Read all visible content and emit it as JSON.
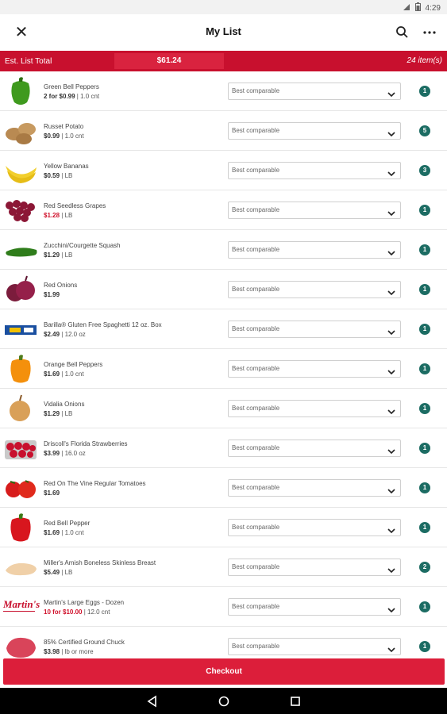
{
  "status": {
    "time": "4:29"
  },
  "appbar": {
    "title": "My List",
    "close_icon": "close-icon",
    "search_icon": "search-icon",
    "more_icon": "more-vert-icon"
  },
  "summary": {
    "label": "Est. List Total",
    "total": "$61.24",
    "count": "24 item(s)"
  },
  "colors": {
    "brand_red": "#c8102e",
    "qty_green": "#1c6c63",
    "sale_red": "#d0112b"
  },
  "select_default": "Best comparable",
  "items": [
    {
      "name": "Green Bell Peppers",
      "price": "2 for $0.99",
      "unit": "1.0 cnt",
      "sale": false,
      "qty": "1",
      "icon": "green-pepper"
    },
    {
      "name": "Russet Potato",
      "price": "$0.99",
      "unit": "1.0 cnt",
      "sale": false,
      "qty": "5",
      "icon": "potato"
    },
    {
      "name": "Yellow Bananas",
      "price": "$0.59",
      "unit": "LB",
      "sale": false,
      "qty": "3",
      "icon": "banana"
    },
    {
      "name": "Red Seedless Grapes",
      "price": "$1.28",
      "unit": "LB",
      "sale": true,
      "qty": "1",
      "icon": "grapes"
    },
    {
      "name": "Zucchini/Courgette Squash",
      "price": "$1.29",
      "unit": "LB",
      "sale": false,
      "qty": "1",
      "icon": "zucchini"
    },
    {
      "name": "Red Onions",
      "price": "$1.99",
      "unit": "",
      "sale": false,
      "qty": "1",
      "icon": "red-onion"
    },
    {
      "name": "Barilla® Gluten Free Spaghetti 12 oz. Box",
      "price": "$2.49",
      "unit": "12.0 oz",
      "sale": false,
      "qty": "1",
      "icon": "pasta-box"
    },
    {
      "name": "Orange Bell Peppers",
      "price": "$1.69",
      "unit": "1.0 cnt",
      "sale": false,
      "qty": "1",
      "icon": "orange-pepper"
    },
    {
      "name": "Vidalia Onions",
      "price": "$1.29",
      "unit": "LB",
      "sale": false,
      "qty": "1",
      "icon": "onion"
    },
    {
      "name": "Driscoll's Florida Strawberries",
      "price": "$3.99",
      "unit": "16.0 oz",
      "sale": false,
      "qty": "1",
      "icon": "strawberries"
    },
    {
      "name": "Red On The Vine Regular Tomatoes",
      "price": "$1.69",
      "unit": "",
      "sale": false,
      "qty": "1",
      "icon": "tomatoes"
    },
    {
      "name": "Red Bell Pepper",
      "price": "$1.69",
      "unit": "1.0 cnt",
      "sale": false,
      "qty": "1",
      "icon": "red-pepper"
    },
    {
      "name": "Miller's Amish Boneless Skinless Breast",
      "price": "$5.49",
      "unit": "LB",
      "sale": false,
      "qty": "2",
      "icon": "chicken"
    },
    {
      "name": "Martin's Large Eggs - Dozen",
      "price": "10 for $10.00",
      "unit": "12.0 cnt",
      "sale": true,
      "qty": "1",
      "icon": "martins-logo",
      "logo_text": "Martin's"
    },
    {
      "name": "85% Certified Ground Chuck",
      "price": "$3.98",
      "unit": "lb or more",
      "sale": false,
      "qty": "1",
      "icon": "ground-beef"
    }
  ],
  "checkout": {
    "label": "Checkout"
  },
  "nav": {
    "back_icon": "back-icon",
    "home_icon": "home-icon",
    "recents_icon": "recents-icon"
  }
}
